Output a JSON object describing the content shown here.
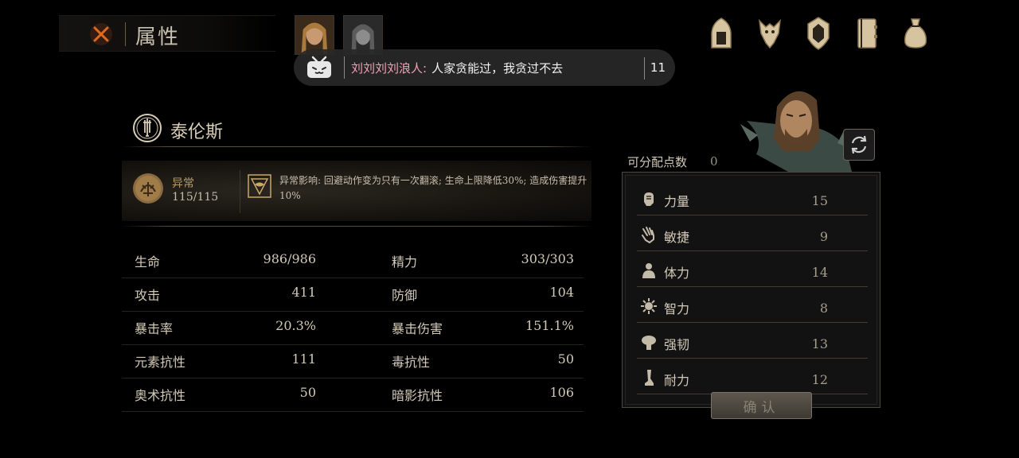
{
  "header": {
    "title": "属性"
  },
  "danmaku": {
    "user": "刘刘刘刘浪人:",
    "text": "人家贪能过，我贪过不去",
    "count": "11"
  },
  "top_icons": [
    "helmet-icon",
    "wolf-crest-icon",
    "shield-crest-icon",
    "journal-icon",
    "pouch-icon"
  ],
  "character": {
    "name": "泰伦斯"
  },
  "status": {
    "label": "异常",
    "value": "115/115",
    "effect": "异常影响: 回避动作变为只有一次翻滚; 生命上限降低30%; 造成伤害提升10%"
  },
  "stats": [
    {
      "label1": "生命",
      "value1": "986/986",
      "label2": "精力",
      "value2": "303/303"
    },
    {
      "label1": "攻击",
      "value1": "411",
      "label2": "防御",
      "value2": "104"
    },
    {
      "label1": "暴击率",
      "value1": "20.3%",
      "label2": "暴击伤害",
      "value2": "151.1%"
    },
    {
      "label1": "元素抗性",
      "value1": "111",
      "label2": "毒抗性",
      "value2": "50"
    },
    {
      "label1": "奥术抗性",
      "value1": "50",
      "label2": "暗影抗性",
      "value2": "106"
    }
  ],
  "attributes": {
    "points_label": "可分配点数",
    "points_value": "0",
    "items": [
      {
        "name": "力量",
        "value": "15",
        "icon": "fist-icon"
      },
      {
        "name": "敏捷",
        "value": "9",
        "icon": "hand-icon"
      },
      {
        "name": "体力",
        "value": "14",
        "icon": "body-icon"
      },
      {
        "name": "智力",
        "value": "8",
        "icon": "mind-icon"
      },
      {
        "name": "强韧",
        "value": "13",
        "icon": "tree-icon"
      },
      {
        "name": "耐力",
        "value": "12",
        "icon": "leg-icon"
      }
    ],
    "confirm_label": "确认"
  },
  "colors": {
    "accent": "#b89a6a",
    "danmaku_user": "#f0a2b8",
    "close_x": "#e06a1c"
  }
}
